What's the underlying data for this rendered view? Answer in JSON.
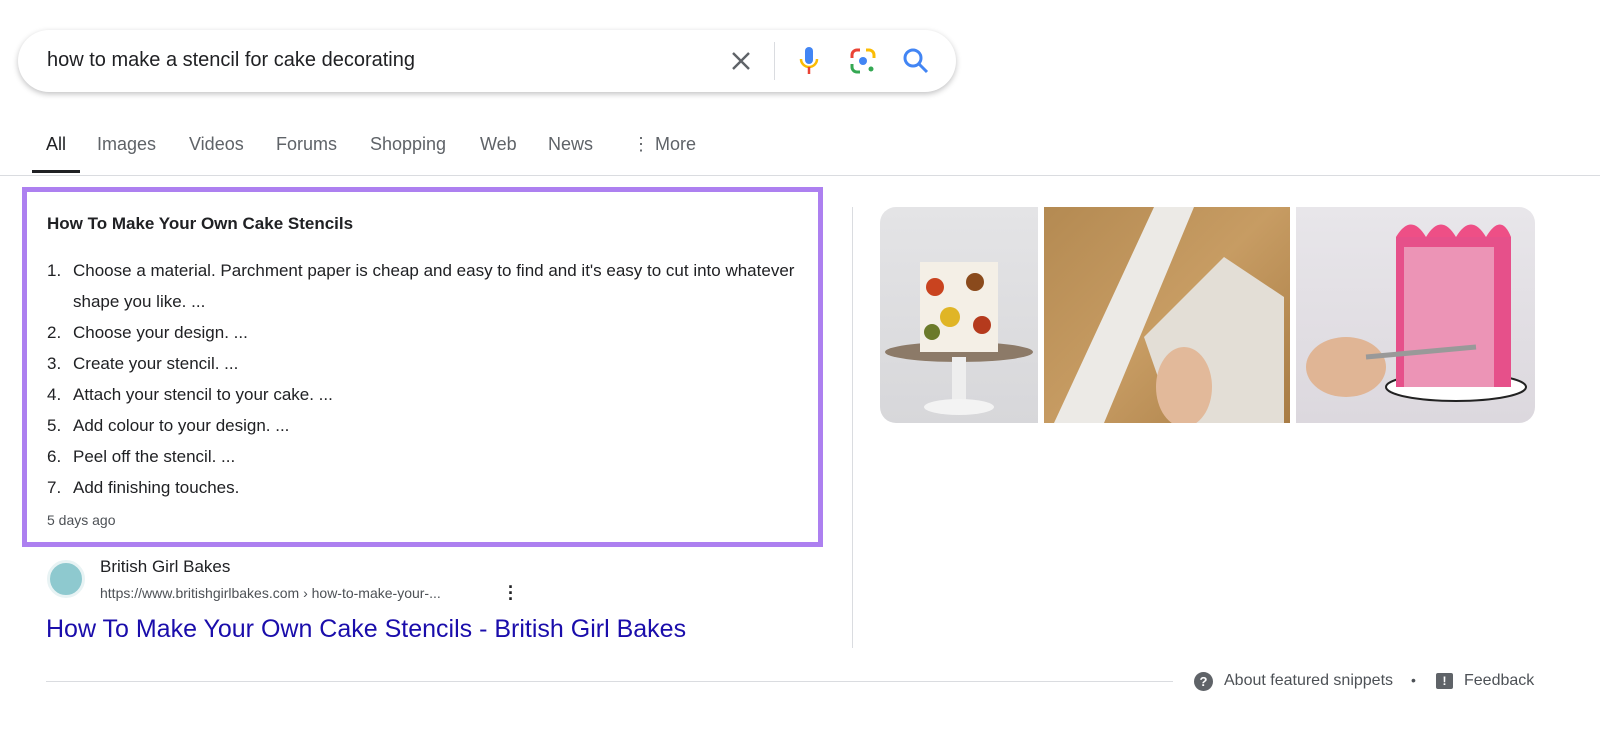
{
  "search": {
    "query": "how to make a stencil for cake decorating"
  },
  "tabs": [
    {
      "label": "All",
      "active": true
    },
    {
      "label": "Images"
    },
    {
      "label": "Videos"
    },
    {
      "label": "Forums"
    },
    {
      "label": "Shopping"
    },
    {
      "label": "Web"
    },
    {
      "label": "News"
    },
    {
      "label": "More"
    }
  ],
  "snippet": {
    "title": "How To Make Your Own Cake Stencils",
    "steps": [
      {
        "n": "1.",
        "text": "Choose a material. Parchment paper is cheap and easy to find and it's easy to cut into whatever shape you like. ..."
      },
      {
        "n": "2.",
        "text": "Choose your design. ..."
      },
      {
        "n": "3.",
        "text": "Create your stencil. ..."
      },
      {
        "n": "4.",
        "text": "Attach your stencil to your cake. ..."
      },
      {
        "n": "5.",
        "text": "Add colour to your design. ..."
      },
      {
        "n": "6.",
        "text": "Peel off the stencil. ..."
      },
      {
        "n": "7.",
        "text": "Add finishing touches."
      }
    ],
    "age": "5 days ago",
    "highlight_color": "#ad80f0"
  },
  "source": {
    "site": "British Girl Bakes",
    "url": "https://www.britishgirlbakes.com › how-to-make-your-...",
    "link": "How To Make Your Own Cake Stencils - British Girl Bakes",
    "link_color": "#1a0dab"
  },
  "footer": {
    "about": "About featured snippets",
    "sep": "•",
    "feedback": "Feedback"
  }
}
